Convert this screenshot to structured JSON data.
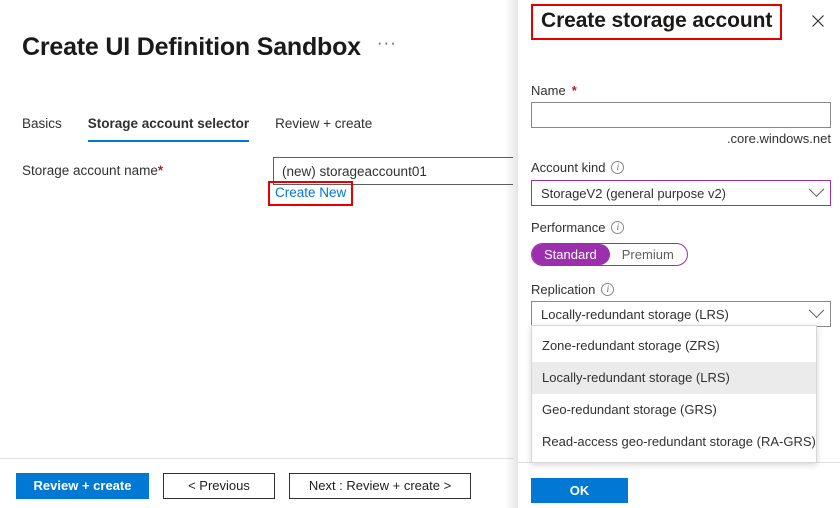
{
  "left_panel": {
    "title": "Create UI Definition Sandbox",
    "more_menu": "···",
    "tabs": [
      {
        "label": "Basics",
        "active": false
      },
      {
        "label": "Storage account selector",
        "active": true
      },
      {
        "label": "Review + create",
        "active": false
      }
    ],
    "field": {
      "label": "Storage account name",
      "required_marker": "*",
      "value": "(new) storageaccount01",
      "placeholder": "",
      "create_new_link": "Create New"
    },
    "footer": {
      "review_create": "Review + create",
      "previous": "< Previous",
      "next": "Next : Review + create >"
    }
  },
  "blade": {
    "title": "Create storage account",
    "close_icon": "close-icon",
    "name_field": {
      "label": "Name",
      "required_marker": "*",
      "value": "",
      "placeholder": "",
      "suffix": ".core.windows.net"
    },
    "account_kind": {
      "label": "Account kind",
      "info_icon": "info-icon",
      "selected": "StorageV2 (general purpose v2)"
    },
    "performance": {
      "label": "Performance",
      "info_icon": "info-icon",
      "options": [
        "Standard",
        "Premium"
      ],
      "selected": "Standard"
    },
    "replication": {
      "label": "Replication",
      "info_icon": "info-icon",
      "selected": "Locally-redundant storage (LRS)",
      "options": [
        {
          "label": "Zone-redundant storage (ZRS)",
          "selected": false
        },
        {
          "label": "Locally-redundant storage (LRS)",
          "selected": true
        },
        {
          "label": "Geo-redundant storage (GRS)",
          "selected": false
        },
        {
          "label": "Read-access geo-redundant storage (RA-GRS)",
          "selected": false
        }
      ]
    },
    "ok_button": "OK"
  },
  "colors": {
    "accent_blue": "#0078d4",
    "purple": "#9b2fae",
    "highlight_red": "#e60000",
    "required_red": "#a4262c",
    "selected_row_grey": "#ebebeb"
  }
}
